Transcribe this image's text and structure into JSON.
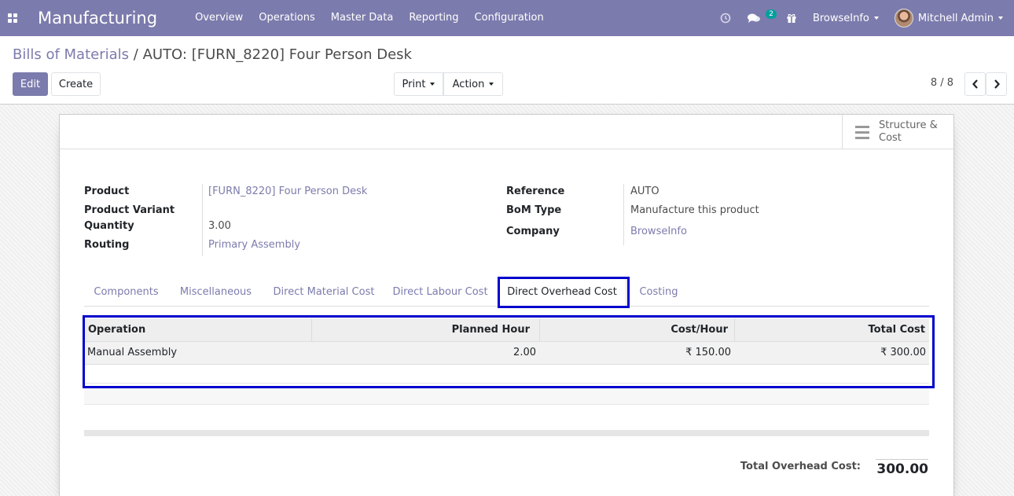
{
  "navbar": {
    "app_name": "Manufacturing",
    "menu": [
      "Overview",
      "Operations",
      "Master Data",
      "Reporting",
      "Configuration"
    ],
    "chat_badge": "2",
    "company": "BrowseInfo",
    "user": "Mitchell Admin",
    "icons": [
      "apps-grid-icon",
      "clock-icon",
      "chat-icon",
      "gift-icon"
    ]
  },
  "control": {
    "breadcrumb_parent": "Bills of Materials",
    "breadcrumb_separator": "/",
    "breadcrumb_current": "AUTO: [FURN_8220] Four Person Desk",
    "edit_label": "Edit",
    "create_label": "Create",
    "print_label": "Print",
    "action_label": "Action",
    "pager": "8 / 8"
  },
  "stat_button": {
    "label": "Structure & Cost"
  },
  "fields": {
    "product_label": "Product",
    "product_value": "[FURN_8220] Four Person Desk",
    "variant_label": "Product Variant",
    "variant_value": "",
    "quantity_label": "Quantity",
    "quantity_value": "3.00",
    "routing_label": "Routing",
    "routing_value": "Primary Assembly",
    "reference_label": "Reference",
    "reference_value": "AUTO",
    "bomtype_label": "BoM Type",
    "bomtype_value": "Manufacture this product",
    "company_label": "Company",
    "company_value": "BrowseInfo"
  },
  "tabs": [
    "Components",
    "Miscellaneous",
    "Direct Material Cost",
    "Direct Labour Cost",
    "Direct Overhead Cost",
    "Costing"
  ],
  "active_tab": "Direct Overhead Cost",
  "table": {
    "headers": [
      "Operation",
      "Planned Hour",
      "Cost/Hour",
      "Total Cost"
    ],
    "rows": [
      [
        "Manual Assembly",
        "2.00",
        "₹ 150.00",
        "₹ 300.00"
      ]
    ]
  },
  "totals": {
    "label": "Total Overhead Cost:",
    "value": "300.00"
  },
  "colors": {
    "brand": "#7c7bad",
    "highlight": "#0000cc"
  }
}
